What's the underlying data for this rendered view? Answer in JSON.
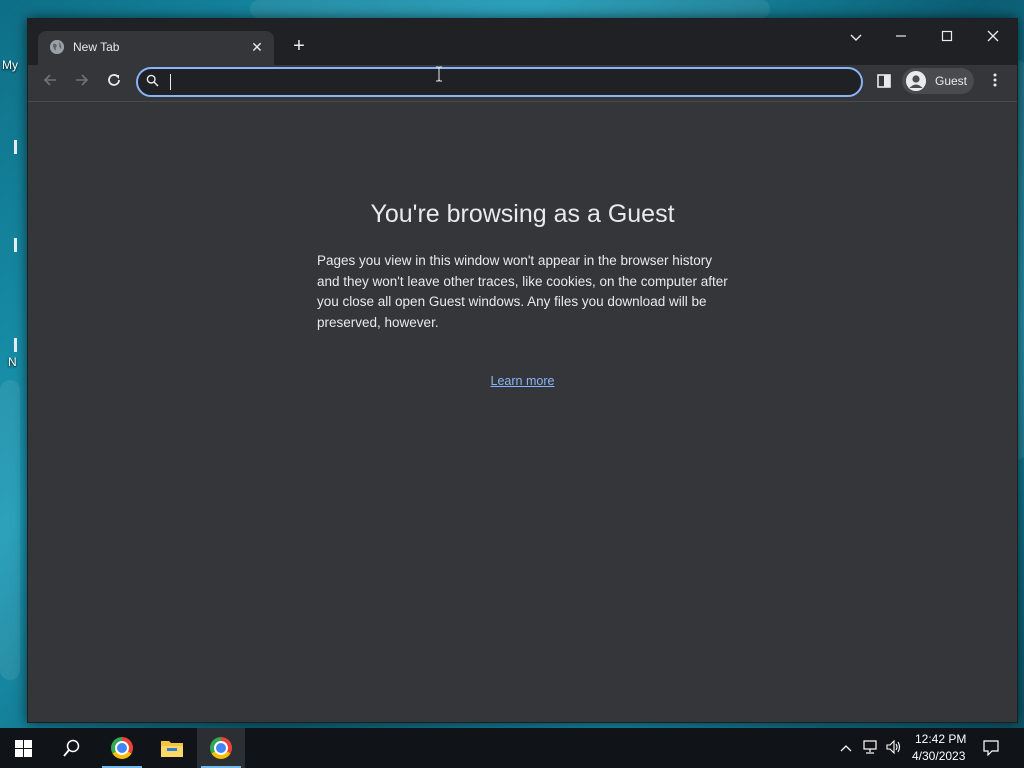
{
  "desktop": {
    "icon_labels": [
      "My",
      "N"
    ]
  },
  "browser": {
    "tab": {
      "title": "New Tab",
      "close_symbol": "✕",
      "favicon": "globe-icon"
    },
    "new_tab_symbol": "+",
    "window_controls": {
      "tab_search": "⌄",
      "minimize": "—",
      "maximize": "☐",
      "close": "✕"
    },
    "toolbar": {
      "back_symbol": "←",
      "forward_symbol": "→",
      "reload_symbol": "↻",
      "omnibox": {
        "value": "",
        "placeholder": ""
      },
      "profile_label": "Guest",
      "menu_symbol": "⋮"
    },
    "page": {
      "heading": "You're browsing as a Guest",
      "body": "Pages you view in this window won't appear in the browser history and they won't leave other traces, like cookies, on the computer after you close all open Guest windows. Any files you download will be preserved, however.",
      "learn_more": "Learn more"
    },
    "colors": {
      "accent": "#8ab4f8",
      "frame": "#202124",
      "surface": "#35363a",
      "text": "#e8eaed"
    }
  },
  "taskbar": {
    "apps": [
      "start-button",
      "search-button",
      "chrome",
      "file-explorer",
      "chrome-active"
    ],
    "clock": {
      "time": "12:42 PM",
      "date": "4/30/2023"
    },
    "tray": {
      "chevron": "^",
      "notifications": "🗨"
    }
  }
}
